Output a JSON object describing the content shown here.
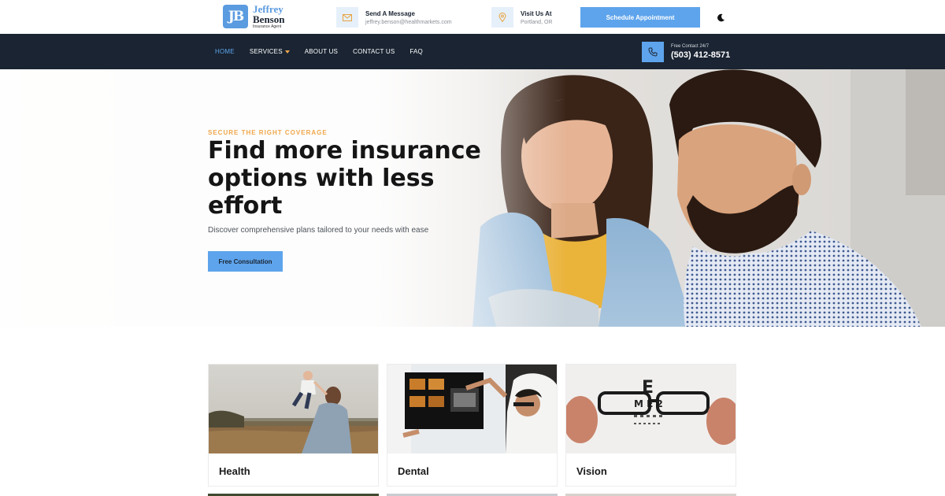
{
  "logo": {
    "mark": "JB",
    "first": "Jeffrey",
    "last": "Benson",
    "subtitle": "Insurance Agent"
  },
  "header": {
    "message": {
      "title": "Send A Message",
      "detail": "jeffrey.benson@healthmarkets.com",
      "icon": "mail-icon"
    },
    "location": {
      "title": "Visit Us At",
      "detail": "Portland, OR",
      "icon": "map-pin-icon"
    },
    "cta_label": "Schedule Appointment",
    "theme_icon": "moon-icon"
  },
  "nav": {
    "items": [
      {
        "label": "HOME",
        "active": true
      },
      {
        "label": "SERVICES",
        "dropdown": true
      },
      {
        "label": "ABOUT US"
      },
      {
        "label": "CONTACT US"
      },
      {
        "label": "FAQ"
      }
    ],
    "phone_label": "Free Contact 24/7",
    "phone_number": "(503) 412-8571"
  },
  "hero": {
    "eyebrow": "SECURE THE RIGHT COVERAGE",
    "title": "Find more insurance options with less effort",
    "description": "Discover comprehensive plans tailored to your needs with ease",
    "button": "Free Consultation"
  },
  "cards": [
    {
      "title": "Health"
    },
    {
      "title": "Dental"
    },
    {
      "title": "Vision"
    }
  ],
  "colors": {
    "accent": "#5ea4ec",
    "navy": "#1a2432",
    "orange": "#f0a64a"
  }
}
